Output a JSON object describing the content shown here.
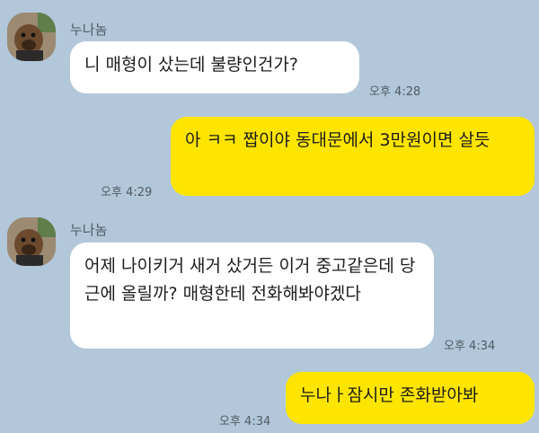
{
  "messages": [
    {
      "sender": "누나놈",
      "text": "니 매형이 샀는데 불량인건가?",
      "time": "오후 4:28"
    },
    {
      "text": "아 ㅋㅋ 짭이야 동대문에서 3만원이면 살듯",
      "time": "오후 4:29"
    },
    {
      "sender": "누나놈",
      "text": "어제 나이키거 새거 샀거든 이거 중고같은데 당근에 올릴까? 매형한테 전화해봐야겠다",
      "time": "오후 4:34"
    },
    {
      "text": "누나ㅏ잠시만 존화받아봐",
      "time": "오후 4:34"
    }
  ]
}
